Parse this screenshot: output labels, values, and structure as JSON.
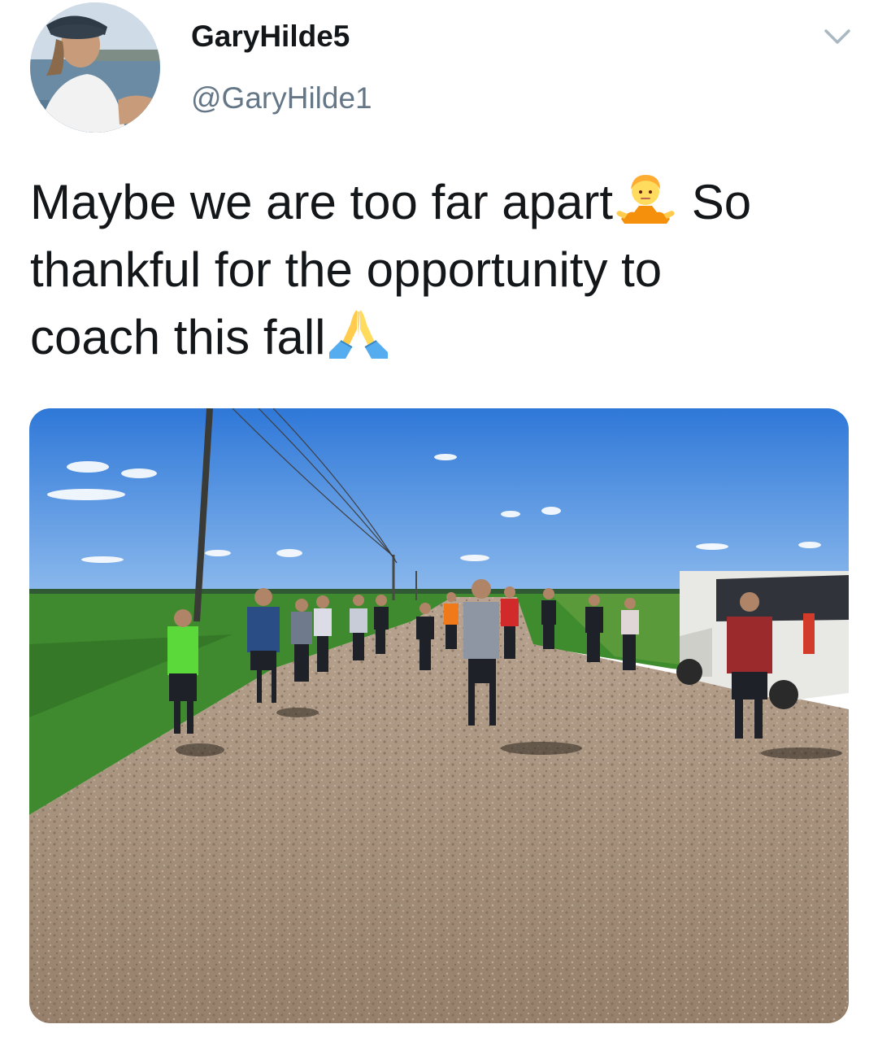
{
  "tweet": {
    "author": {
      "display_name": "GaryHilde5",
      "handle": "@GaryHilde1",
      "avatar_icon": "profile-photo"
    },
    "menu_icon": "chevron-down-icon",
    "text_lines": [
      {
        "before": "Maybe we are too far apart",
        "emoji": "person-shrugging",
        "after": " So"
      },
      {
        "before": "thankful for the opportunity to",
        "emoji": "",
        "after": ""
      },
      {
        "before": "coach this fall",
        "emoji": "folded-hands",
        "after": ""
      }
    ],
    "media": {
      "type": "photo",
      "scene": "gravel-road-with-runners"
    }
  },
  "colors": {
    "text_primary": "#14171a",
    "text_secondary": "#657786",
    "sky": "#3f86e0",
    "gravel": "#a08b76",
    "field": "#3f8a2e"
  }
}
